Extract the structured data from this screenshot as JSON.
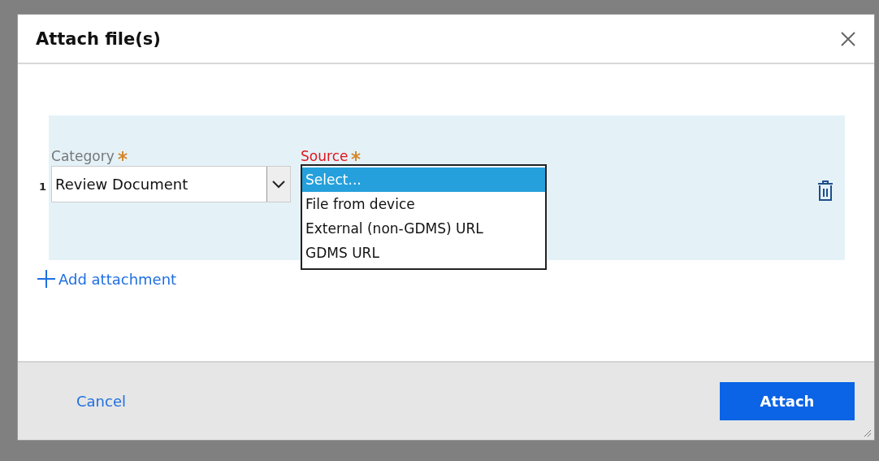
{
  "dialog": {
    "title": "Attach file(s)"
  },
  "attachments": [
    {
      "number": "1",
      "category": {
        "label": "Category",
        "required": true,
        "value": "Review Document"
      },
      "source": {
        "label": "Source",
        "required": true,
        "invalid": true,
        "expanded": true,
        "options": [
          {
            "label": "Select...",
            "selected": true
          },
          {
            "label": "File from device",
            "selected": false
          },
          {
            "label": "External (non-GDMS) URL",
            "selected": false
          },
          {
            "label": "GDMS URL",
            "selected": false
          }
        ]
      }
    }
  ],
  "add_link": "Add attachment",
  "footer": {
    "cancel": "Cancel",
    "submit": "Attach"
  }
}
